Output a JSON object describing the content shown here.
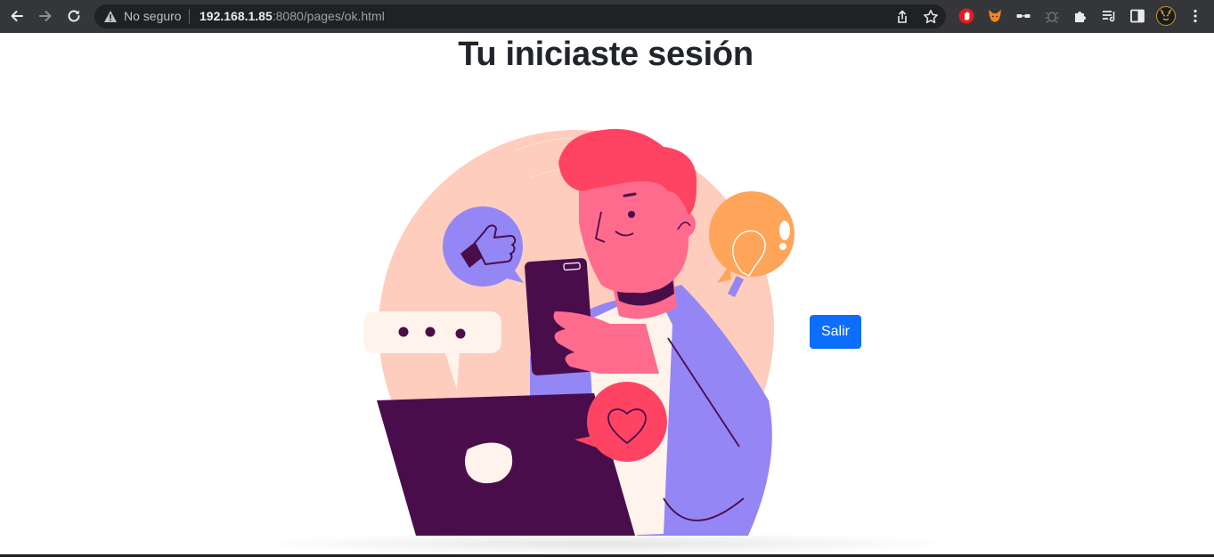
{
  "browser": {
    "security_label": "No seguro",
    "url_host": "192.168.1.85",
    "url_rest": ":8080/pages/ok.html",
    "icons": [
      "back-icon",
      "forward-icon",
      "reload-icon",
      "warning-icon",
      "share-icon",
      "bookmark-star-icon",
      "extension-stop-icon",
      "extension-fox-icon",
      "extension-glasses-icon",
      "extension-bug-icon",
      "extensions-puzzle-icon",
      "reading-list-icon",
      "side-panel-icon",
      "profile-avatar-icon",
      "menu-icon"
    ]
  },
  "page": {
    "title": "Tu iniciaste sesión",
    "logout_label": "Salir"
  },
  "colors": {
    "toolbar": "#35363a",
    "omnibox": "#202124",
    "button_primary": "#0d6efd",
    "title_text": "#212529"
  }
}
